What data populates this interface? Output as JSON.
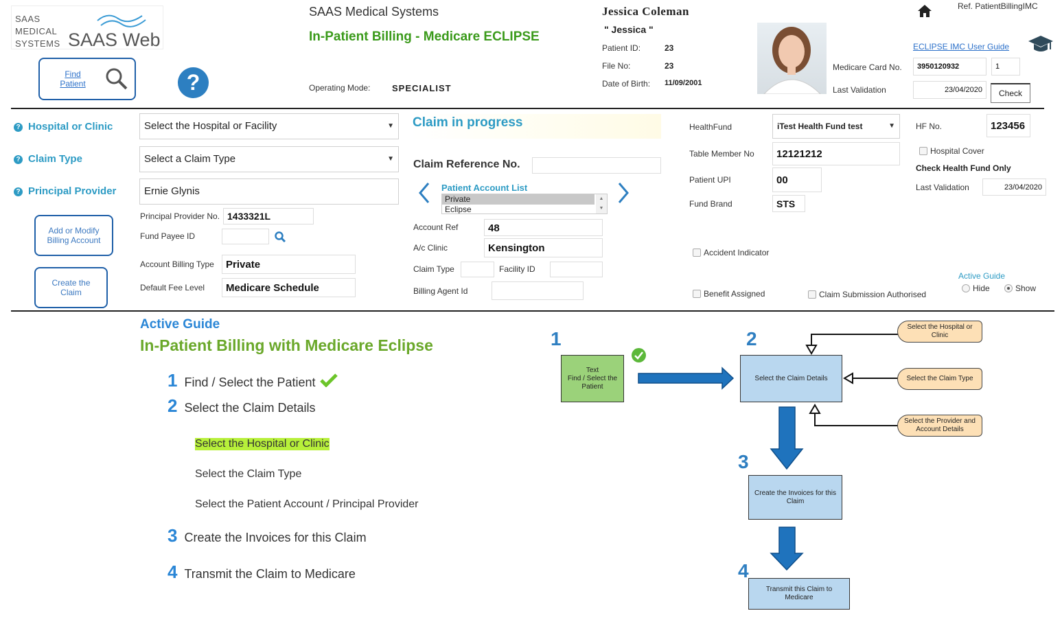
{
  "colors": {
    "accent_blue": "#2d9bc4",
    "green_title": "#3a9a1a",
    "button_border": "#1e5fa8",
    "highlight": "#b7f03a"
  },
  "logo": {
    "line1": "SAAS",
    "line2": "MEDICAL",
    "line3": "SYSTEMS",
    "brand": "SAAS Web"
  },
  "header": {
    "company": "SAAS Medical Systems",
    "page_title": "In-Patient Billing - Medicare ECLIPSE",
    "operating_mode_label": "Operating Mode:",
    "operating_mode_value": "SPECIALIST",
    "find_patient": "Find Patient",
    "help_icon": "question-icon",
    "ref": "Ref. PatientBillingIMC",
    "user_guide_link": "ECLIPSE IMC User Guide"
  },
  "patient": {
    "name": "Jessica Coleman",
    "nickname": "\" Jessica \"",
    "id_label": "Patient ID:",
    "id_value": "23",
    "file_label": "File No:",
    "file_value": "23",
    "dob_label": "Date of Birth:",
    "dob_value": "11/09/2001",
    "medicare_label": "Medicare Card No.",
    "medicare_value": "3950120932",
    "medicare_irn": "1",
    "last_validation_label": "Last Validation",
    "last_validation_value": "23/04/2020",
    "check_button": "Check"
  },
  "left": {
    "hospital_label": "Hospital or Clinic",
    "hospital_select": "Select the Hospital or Facility",
    "claim_type_label": "Claim Type",
    "claim_type_select": "Select a Claim Type",
    "principal_provider_label": "Principal Provider",
    "principal_provider_value": "Ernie Glynis",
    "add_modify_button": "Add or Modify Billing Account",
    "create_claim_button": "Create the Claim",
    "provider_no_label": "Principal Provider No.",
    "provider_no_value": "1433321L",
    "fund_payee_label": "Fund Payee ID",
    "fund_payee_value": "",
    "account_billing_type_label": "Account Billing Type",
    "account_billing_type_value": "Private",
    "default_fee_label": "Default Fee Level",
    "default_fee_value": "Medicare Schedule"
  },
  "middle": {
    "claim_status": "Claim in progress",
    "claim_ref_label": "Claim Reference No.",
    "claim_ref_value": "",
    "account_list_title": "Patient Account List",
    "account_list_items": [
      "Private",
      "Eclipse"
    ],
    "account_ref_label": "Account Ref",
    "account_ref_value": "48",
    "ac_clinic_label": "A/c Clinic",
    "ac_clinic_value": "Kensington",
    "claim_type_label": "Claim Type",
    "claim_type_value": "",
    "facility_id_label": "Facility ID",
    "facility_id_value": "",
    "billing_agent_label": "Billing Agent Id",
    "billing_agent_value": ""
  },
  "right": {
    "healthfund_label": "HealthFund",
    "healthfund_value": "iTest Health Fund test",
    "hf_no_label": "HF No.",
    "hf_no_value": "123456",
    "table_member_label": "Table Member No",
    "table_member_value": "12121212",
    "hospital_cover_label": "Hospital Cover",
    "check_hf_only": "Check Health Fund Only",
    "patient_upi_label": "Patient UPI",
    "patient_upi_value": "00",
    "last_validation_label": "Last Validation",
    "last_validation_value": "23/04/2020",
    "fund_brand_label": "Fund Brand",
    "fund_brand_value": "STS",
    "accident_indicator": "Accident Indicator",
    "benefit_assigned": "Benefit Assigned",
    "claim_submission": "Claim Submission Authorised",
    "active_guide_label": "Active Guide",
    "hide_label": "Hide",
    "show_label": "Show"
  },
  "guide": {
    "heading": "Active Guide",
    "title": "In-Patient Billing with Medicare Eclipse",
    "steps": [
      {
        "num": "1",
        "text": "Find / Select the Patient"
      },
      {
        "num": "2",
        "text": "Select the Claim Details"
      },
      {
        "num": "3",
        "text": "Create the Invoices for this Claim"
      },
      {
        "num": "4",
        "text": "Transmit the Claim to Medicare"
      }
    ],
    "substeps": [
      "Select the Hospital or Clinic",
      "Select the Claim Type",
      "Select the Patient Account / Principal Provider"
    ]
  },
  "diagram": {
    "nums": [
      "1",
      "2",
      "3",
      "4"
    ],
    "box1_line1": "Text",
    "box1_line2": "Find / Select the Patient",
    "box2": "Select the Claim Details",
    "box3": "Create the Invoices for this Claim",
    "box4": "Transmit this Claim to Medicare",
    "tag1": "Select the Hospital or Clinic",
    "tag2": "Select the Claim Type",
    "tag3": "Select the Provider and Account  Details"
  }
}
